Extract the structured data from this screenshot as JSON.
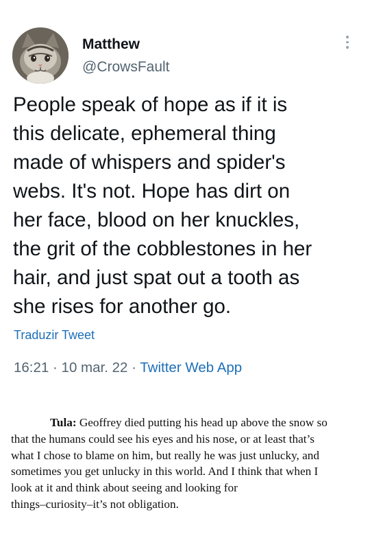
{
  "tweet": {
    "author": {
      "display_name": "Matthew",
      "handle": "@CrowsFault",
      "avatar_icon": "cat-avatar"
    },
    "text_lines": [
      "People speak of hope as if it is",
      "this delicate, ephemeral thing",
      "made of whispers and spider's",
      "webs. It's not. Hope has dirt on",
      "her face, blood on her knuckles,",
      "the grit of the cobblestones in her",
      "hair, and just spat out a tooth as",
      "she rises for another go."
    ],
    "translate_label": "Traduzir Tweet",
    "time": "16:21",
    "separator": "·",
    "date": "10 mar. 22",
    "source_app": "Twitter Web App",
    "more_icon": "more-vertical-icon"
  },
  "quote": {
    "speaker": "Tula:",
    "first_line": "Geoffrey died putting his head up above the snow so",
    "lines": [
      "that the humans could see his eyes and his nose, or at least that’s",
      "what I chose to blame on him, but really he was just unlucky, and",
      "sometimes you get unlucky in this world. And I think that when I",
      "look at it and think about seeing and looking for",
      "things–curiosity–it’s not obligation."
    ]
  },
  "colors": {
    "text_primary": "#0f1419",
    "text_secondary": "#536471",
    "link": "#1d6fb8"
  }
}
